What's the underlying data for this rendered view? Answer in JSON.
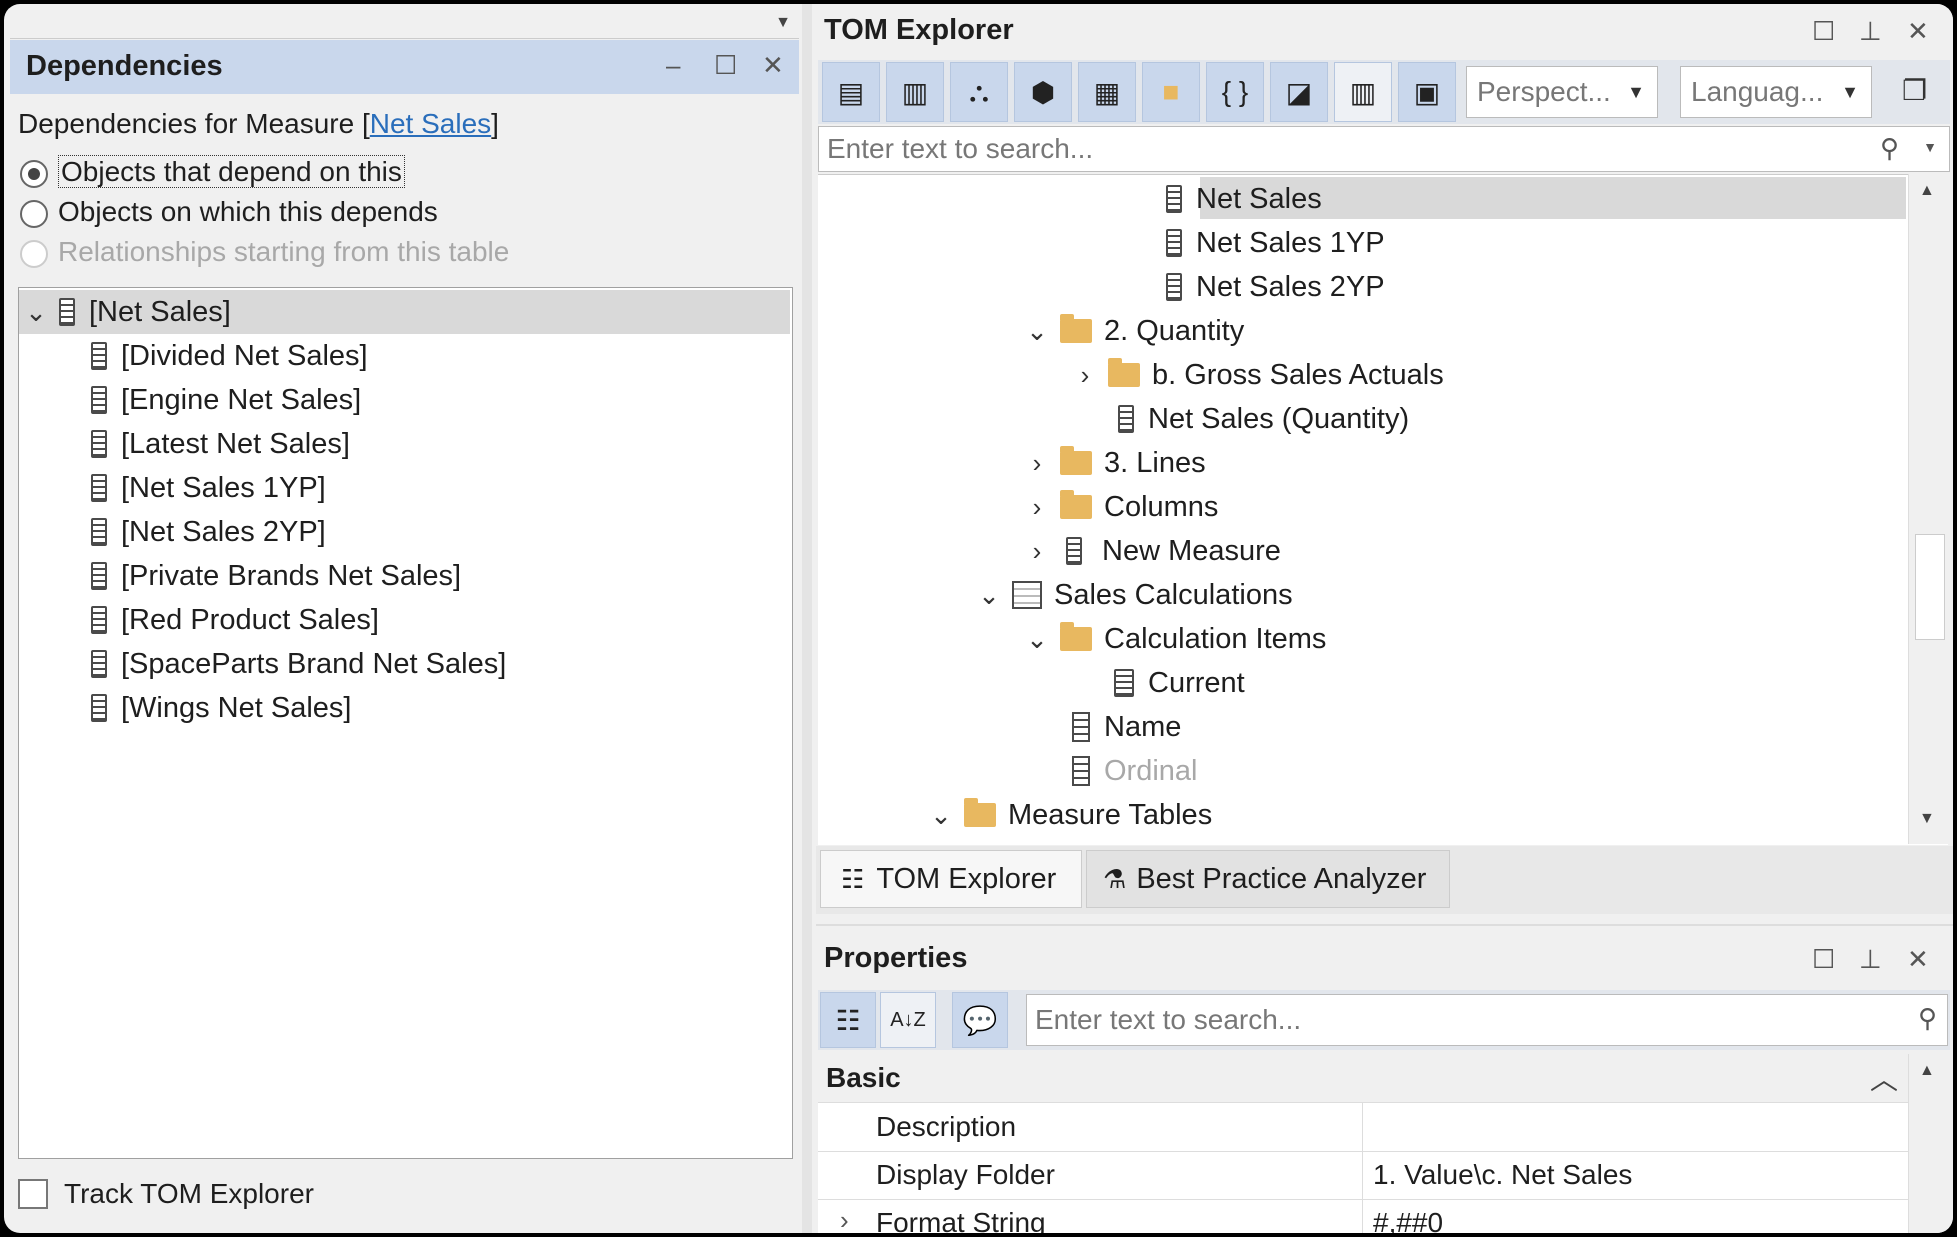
{
  "dependencies": {
    "title": "Dependencies",
    "caption_prefix": "Dependencies for Measure ",
    "caption_link": "Net Sales",
    "options": [
      {
        "label": "Objects that depend on this",
        "checked": true,
        "disabled": false
      },
      {
        "label": "Objects on which this depends",
        "checked": false,
        "disabled": false
      },
      {
        "label": "Relationships starting from this table",
        "checked": false,
        "disabled": true
      }
    ],
    "root": "[Net Sales]",
    "children": [
      "[Divided Net Sales]",
      "[Engine Net Sales]",
      "[Latest Net Sales]",
      "[Net Sales 1YP]",
      "[Net Sales 2YP]",
      "[Private Brands Net Sales]",
      "[Red Product Sales]",
      "[SpaceParts Brand Net Sales]",
      "[Wings Net Sales]"
    ],
    "track_label": "Track TOM Explorer",
    "track_checked": false
  },
  "tom": {
    "title": "TOM Explorer",
    "perspective_placeholder": "Perspect...",
    "language_placeholder": "Languag...",
    "search_placeholder": "Enter text to search...",
    "tree": [
      {
        "label": "Net Sales",
        "icon": "calculator-icon",
        "chevron": "",
        "selected": true
      },
      {
        "label": "Net Sales 1YP",
        "icon": "calculator-icon",
        "chevron": ""
      },
      {
        "label": "Net Sales 2YP",
        "icon": "calculator-icon",
        "chevron": ""
      },
      {
        "label": "2. Quantity",
        "icon": "open-folder-icon",
        "chevron": "⌄"
      },
      {
        "label": "b. Gross Sales Actuals",
        "icon": "folder-icon",
        "chevron": "›"
      },
      {
        "label": "Net Sales (Quantity)",
        "icon": "calculator-icon",
        "chevron": ""
      },
      {
        "label": "3. Lines",
        "icon": "folder-icon",
        "chevron": "›"
      },
      {
        "label": "Columns",
        "icon": "folder-icon",
        "chevron": "›"
      },
      {
        "label": "New Measure",
        "icon": "calculator-icon",
        "chevron": "›"
      },
      {
        "label": "Sales Calculations",
        "icon": "calc-table-icon",
        "chevron": "⌄"
      },
      {
        "label": "Calculation Items",
        "icon": "calc-items-folder-icon",
        "chevron": "⌄"
      },
      {
        "label": "Current",
        "icon": "calc-item-icon",
        "chevron": ""
      },
      {
        "label": "Name",
        "icon": "column-icon",
        "chevron": ""
      },
      {
        "label": "Ordinal",
        "icon": "column-icon",
        "chevron": "",
        "hidden": true
      },
      {
        "label": "Measure Tables",
        "icon": "measure-table-icon",
        "chevron": "⌄"
      }
    ],
    "tabs": [
      "TOM Explorer",
      "Best Practice Analyzer"
    ]
  },
  "properties": {
    "title": "Properties",
    "search_placeholder": "Enter text to search...",
    "category": "Basic",
    "rows": [
      {
        "key": "Description",
        "value": ""
      },
      {
        "key": "Display Folder",
        "value": "1. Value\\c. Net Sales"
      },
      {
        "key": "Format String",
        "value": "#,##0"
      }
    ]
  }
}
